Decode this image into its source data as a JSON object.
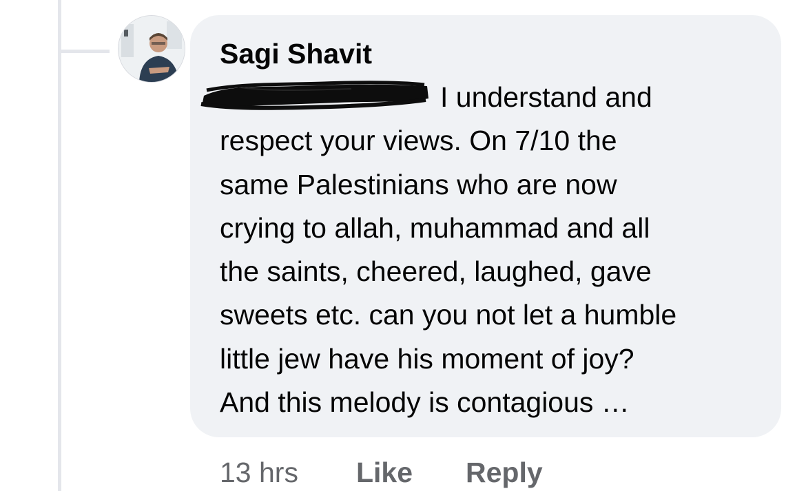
{
  "comment": {
    "author": "Sagi Shavit",
    "text_lines": [
      "I understand and",
      "respect your views. On 7/10 the",
      "same Palestinians who are now",
      "crying to allah, muhammad and all",
      "the saints, cheered, laughed, gave",
      "sweets etc. can you not let a humble",
      "little jew have his moment of joy?",
      "And this melody is contagious …"
    ],
    "timestamp": "13 hrs",
    "like_label": "Like",
    "reply_label": "Reply"
  },
  "colors": {
    "bubble_background": "#f0f2f5",
    "text": "#050505",
    "secondary_text": "#65676b",
    "thread_line": "#e4e6eb"
  }
}
